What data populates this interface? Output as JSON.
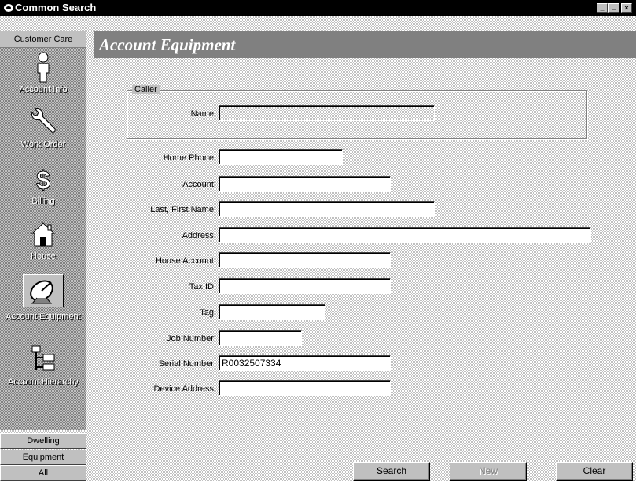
{
  "window": {
    "title": "Common Search",
    "controls": [
      "minimize-icon",
      "maximize-icon",
      "close-icon"
    ]
  },
  "sidebar": {
    "header_tab": "Customer Care",
    "items": [
      {
        "label": "Account Info",
        "icon": "person-icon",
        "active": false
      },
      {
        "label": "Work Order",
        "icon": "wrench-icon",
        "active": false
      },
      {
        "label": "Billing",
        "icon": "dollar-icon",
        "active": false
      },
      {
        "label": "House",
        "icon": "house-icon",
        "active": false
      },
      {
        "label": "Account Equipment",
        "icon": "satellite-dish-icon",
        "active": true
      },
      {
        "label": "Account Hierarchy",
        "icon": "hierarchy-icon",
        "active": false
      }
    ],
    "bottom_tabs": [
      "Dwelling",
      "Equipment",
      "All"
    ]
  },
  "main": {
    "title": "Account Equipment",
    "caller": {
      "legend": "Caller",
      "name_label": "Name:",
      "name_value": ""
    },
    "fields": [
      {
        "label": "Home Phone:",
        "value": ""
      },
      {
        "label": "Account:",
        "value": ""
      },
      {
        "label": "Last, First Name:",
        "value": ""
      },
      {
        "label": "Address:",
        "value": ""
      },
      {
        "label": "House Account:",
        "value": ""
      },
      {
        "label": "Tax ID:",
        "value": ""
      },
      {
        "label": "Tag:",
        "value": ""
      },
      {
        "label": "Job Number:",
        "value": ""
      },
      {
        "label": "Serial Number:",
        "value": "R0032507334"
      },
      {
        "label": "Device Address:",
        "value": ""
      }
    ],
    "buttons": {
      "search": "Search",
      "new": "New",
      "clear": "Clear"
    }
  }
}
